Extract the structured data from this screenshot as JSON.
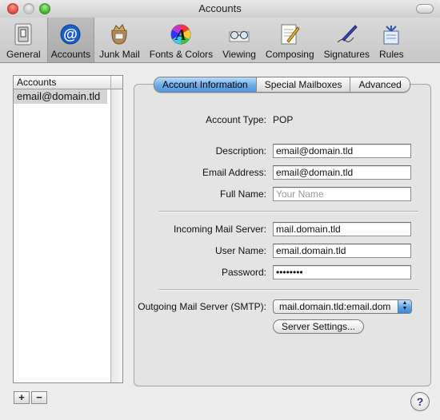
{
  "window": {
    "title": "Accounts"
  },
  "toolbar": {
    "items": [
      {
        "label": "General",
        "icon": "switch-icon"
      },
      {
        "label": "Accounts",
        "icon": "at-sign-icon",
        "selected": true
      },
      {
        "label": "Junk Mail",
        "icon": "junk-mail-bag-icon"
      },
      {
        "label": "Fonts & Colors",
        "icon": "color-wheel-icon"
      },
      {
        "label": "Viewing",
        "icon": "glasses-icon"
      },
      {
        "label": "Composing",
        "icon": "notepad-pencil-icon"
      },
      {
        "label": "Signatures",
        "icon": "pen-icon"
      },
      {
        "label": "Rules",
        "icon": "rules-icon"
      }
    ]
  },
  "accounts": {
    "header": "Accounts",
    "items": [
      "email@domain.tld"
    ],
    "add_label": "+",
    "remove_label": "−"
  },
  "tabs": [
    {
      "label": "Account Information",
      "active": true
    },
    {
      "label": "Special Mailboxes",
      "active": false
    },
    {
      "label": "Advanced",
      "active": false
    }
  ],
  "form": {
    "account_type_label": "Account Type:",
    "account_type_value": "POP",
    "description_label": "Description:",
    "description_value": "email@domain.tld",
    "email_label": "Email Address:",
    "email_value": "email@domain.tld",
    "fullname_label": "Full Name:",
    "fullname_placeholder": "Your Name",
    "incoming_label": "Incoming Mail Server:",
    "incoming_value": "mail.domain.tld",
    "username_label": "User Name:",
    "username_value": "email.domain.tld",
    "password_label": "Password:",
    "password_value": "••••••••",
    "smtp_label": "Outgoing Mail Server (SMTP):",
    "smtp_value": "mail.domain.tld:email.dom",
    "server_settings_label": "Server Settings..."
  },
  "help": {
    "label": "?"
  },
  "colors": {
    "accent": "#5ea4e6",
    "selection": "#d4d4d4"
  }
}
